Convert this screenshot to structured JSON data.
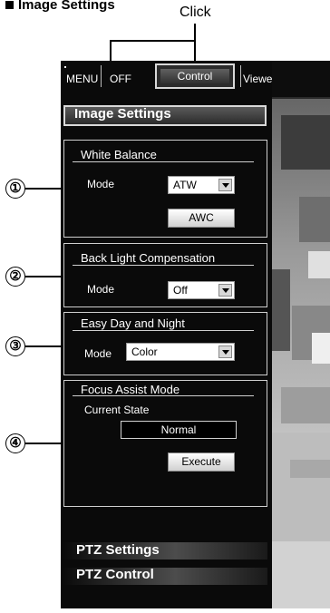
{
  "annotation": {
    "title": "Image Settings",
    "click_label": "Click"
  },
  "topbar": {
    "menu_label": "MENU",
    "off_label": "OFF",
    "control_tab": "Control",
    "viewer_setup_tab": "Viewer Setup"
  },
  "image_settings": {
    "header": "Image Settings",
    "white_balance": {
      "title": "White Balance",
      "mode_label": "Mode",
      "mode_value": "ATW",
      "awc_button": "AWC"
    },
    "backlight": {
      "title": "Back Light Compensation",
      "mode_label": "Mode",
      "mode_value": "Off"
    },
    "day_night": {
      "title": "Easy Day and Night",
      "mode_label": "Mode",
      "mode_value": "Color"
    },
    "focus_assist": {
      "title": "Focus Assist Mode",
      "state_label": "Current State",
      "state_value": "Normal",
      "execute_button": "Execute"
    }
  },
  "callouts": [
    "①",
    "②",
    "③",
    "④"
  ],
  "bottom_nav": {
    "ptz_settings": "PTZ Settings",
    "ptz_control": "PTZ Control"
  }
}
